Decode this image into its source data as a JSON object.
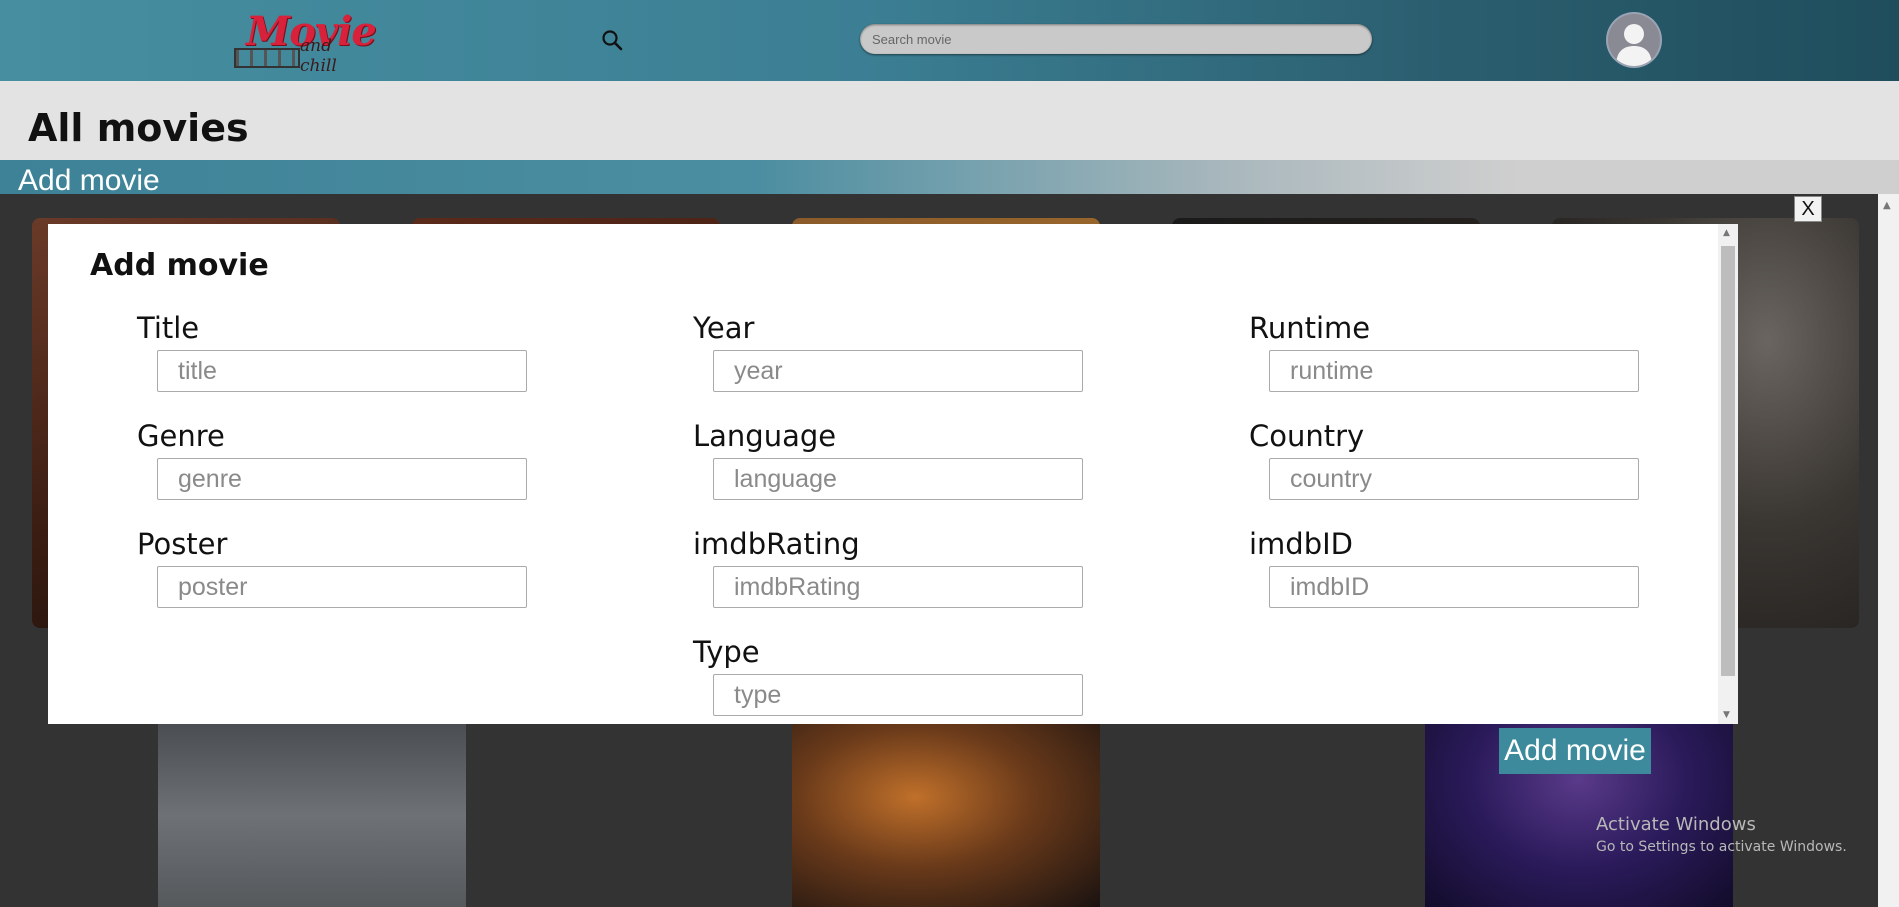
{
  "header": {
    "logo_word": "Movie",
    "logo_sub": "and chill",
    "search_placeholder": "Search movie"
  },
  "page": {
    "title": "All movies",
    "add_bar_label": "Add movie",
    "add_button_label": "Add movie"
  },
  "modal": {
    "close_label": "X",
    "title": "Add movie",
    "fields": [
      {
        "label": "Title",
        "placeholder": "title"
      },
      {
        "label": "Year",
        "placeholder": "year"
      },
      {
        "label": "Runtime",
        "placeholder": "runtime"
      },
      {
        "label": "Genre",
        "placeholder": "genre"
      },
      {
        "label": "Language",
        "placeholder": "language"
      },
      {
        "label": "Country",
        "placeholder": "country"
      },
      {
        "label": "Poster",
        "placeholder": "poster"
      },
      {
        "label": "imdbRating",
        "placeholder": "imdbRating"
      },
      {
        "label": "imdbID",
        "placeholder": "imdbID"
      },
      {
        "label": "Type",
        "placeholder": "type"
      }
    ]
  },
  "watermark": {
    "line1": "Activate Windows",
    "line2": "Go to Settings to activate Windows."
  },
  "icons": {
    "search": "search-icon",
    "avatar": "user-avatar-icon",
    "close": "close-icon"
  },
  "colors": {
    "header": "#3c7f94",
    "accent_button": "#3e8a9d",
    "logo_red": "#d8213a"
  }
}
